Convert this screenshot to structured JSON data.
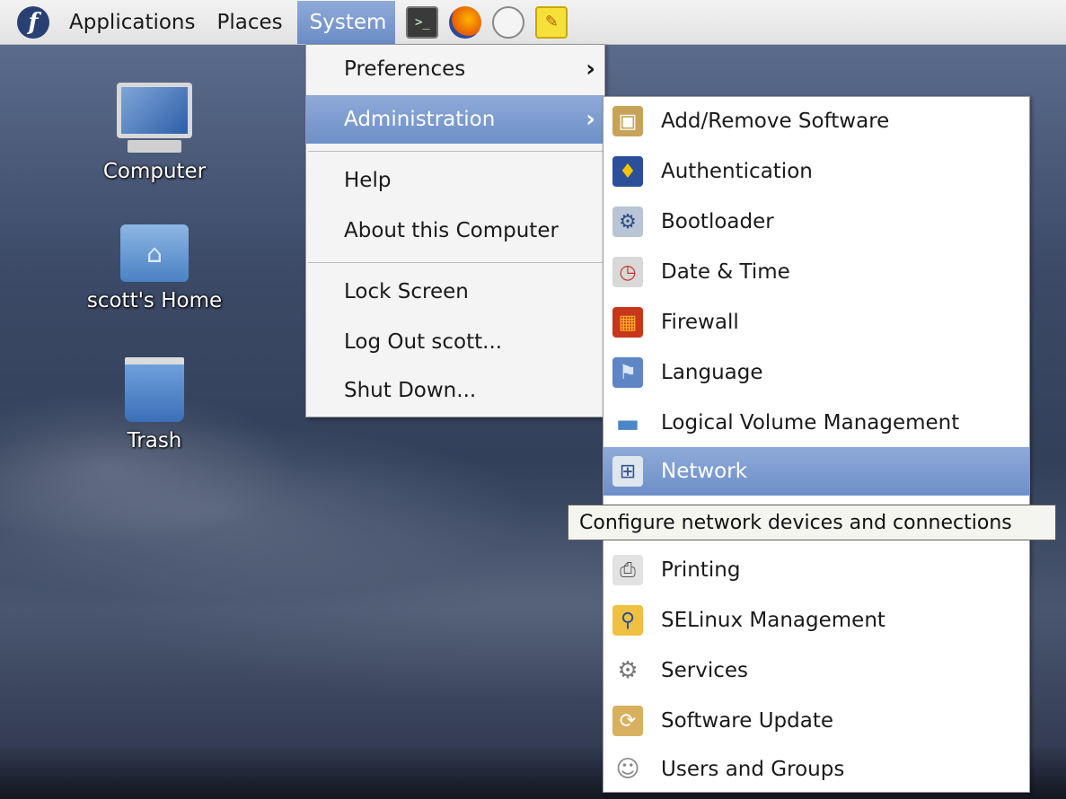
{
  "panel": {
    "menus": [
      "Applications",
      "Places",
      "System"
    ],
    "launchers": [
      "terminal-icon",
      "firefox-icon",
      "mail-icon",
      "notes-icon"
    ]
  },
  "desktop_icons": [
    {
      "label": "Computer",
      "icon": "computer-icon"
    },
    {
      "label": "scott's Home",
      "icon": "home-folder-icon"
    },
    {
      "label": "Trash",
      "icon": "trash-icon"
    }
  ],
  "system_menu": {
    "items": [
      {
        "label": "Preferences",
        "submenu": true
      },
      {
        "label": "Administration",
        "submenu": true,
        "highlighted": true
      },
      {
        "label": "Help"
      },
      {
        "label": "About this Computer"
      },
      {
        "label": "Lock Screen"
      },
      {
        "label": "Log Out scott..."
      },
      {
        "label": "Shut Down..."
      }
    ],
    "arrow": "›"
  },
  "admin_menu": {
    "items": [
      {
        "label": "Add/Remove Software",
        "icon": "package-icon"
      },
      {
        "label": "Authentication",
        "icon": "authentication-icon"
      },
      {
        "label": "Bootloader",
        "icon": "bootloader-icon"
      },
      {
        "label": "Date & Time",
        "icon": "clock-icon"
      },
      {
        "label": "Firewall",
        "icon": "firewall-icon"
      },
      {
        "label": "Language",
        "icon": "flag-icon"
      },
      {
        "label": "Logical Volume Management",
        "icon": "volume-icon"
      },
      {
        "label": "Network",
        "icon": "network-icon",
        "highlighted": true
      },
      {
        "label": "Printing",
        "icon": "printer-icon"
      },
      {
        "label": "SELinux Management",
        "icon": "selinux-icon"
      },
      {
        "label": "Services",
        "icon": "services-icon"
      },
      {
        "label": "Software Update",
        "icon": "software-update-icon"
      },
      {
        "label": "Users and Groups",
        "icon": "users-icon"
      }
    ]
  },
  "tooltip": "Configure network devices and connections",
  "colors": {
    "highlight": "#7f9dd0",
    "panel": "#e8e8e8",
    "desktop": "#3c4a67"
  }
}
